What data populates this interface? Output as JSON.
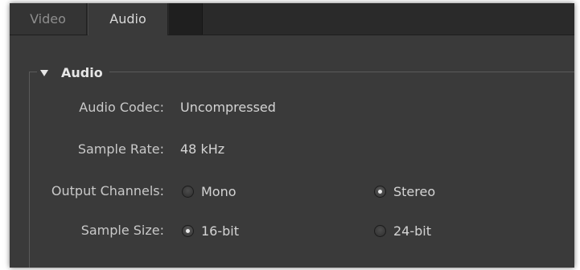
{
  "tabs": [
    {
      "label": "Video",
      "active": false
    },
    {
      "label": "Audio",
      "active": true
    },
    {
      "label": "",
      "active": false
    }
  ],
  "section": {
    "title": "Audio",
    "expanded": true
  },
  "fields": {
    "audio_codec": {
      "label": "Audio Codec:",
      "value": "Uncompressed"
    },
    "sample_rate": {
      "label": "Sample Rate:",
      "value": "48 kHz"
    },
    "output_channels": {
      "label": "Output Channels:",
      "options": [
        {
          "label": "Mono",
          "selected": false
        },
        {
          "label": "Stereo",
          "selected": true
        }
      ]
    },
    "sample_size": {
      "label": "Sample Size:",
      "options": [
        {
          "label": "16-bit",
          "selected": true
        },
        {
          "label": "24-bit",
          "selected": false
        }
      ]
    }
  },
  "colors": {
    "background": "#3a3a3a",
    "tabbar": "#2a2a2a",
    "text": "#d4d4d4",
    "label": "#c9c9c9"
  }
}
